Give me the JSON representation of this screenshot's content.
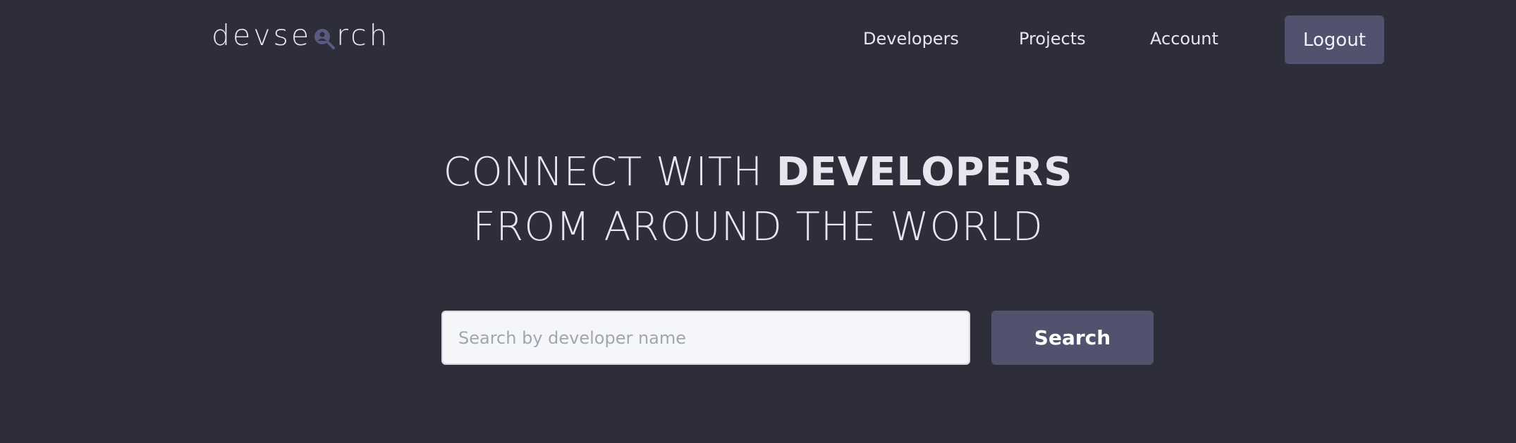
{
  "header": {
    "logo": {
      "prefix": "devse",
      "suffix": "rch",
      "icon": "magnifier-person-icon"
    },
    "nav": [
      {
        "label": "Developers"
      },
      {
        "label": "Projects"
      },
      {
        "label": "Account"
      }
    ],
    "logout_label": "Logout"
  },
  "hero": {
    "line1_light": "CONNECT WITH ",
    "line1_bold": "DEVELOPERS",
    "line2": "FROM AROUND THE WORLD"
  },
  "search": {
    "placeholder": "Search by developer name",
    "value": "",
    "button_label": "Search"
  },
  "colors": {
    "background": "#2e2d3a",
    "accent": "#52526f",
    "text": "#e6e6ef",
    "input_bg": "#f5f6fa"
  }
}
